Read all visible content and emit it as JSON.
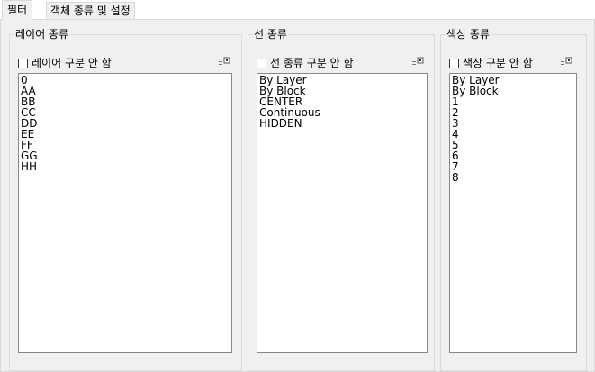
{
  "tabs": [
    {
      "label": "필터",
      "active": true
    },
    {
      "label": "객체 종류 및 설정",
      "active": false
    }
  ],
  "groups": {
    "layer": {
      "title": "레이어 종류",
      "checkbox_label": "레이어 구분 안 함",
      "checked": false,
      "items": [
        "0",
        "AA",
        "BB",
        "CC",
        "DD",
        "EE",
        "FF",
        "GG",
        "HH"
      ]
    },
    "line": {
      "title": "선 종류",
      "checkbox_label": "선 종류 구분 안 함",
      "checked": false,
      "items": [
        "By Layer",
        "By Block",
        "CENTER",
        "Continuous",
        "HIDDEN"
      ]
    },
    "color": {
      "title": "색상 종류",
      "checkbox_label": "색상 구분 안 함",
      "checked": false,
      "items": [
        "By Layer",
        "By Block",
        "1",
        "2",
        "3",
        "4",
        "5",
        "6",
        "7",
        "8"
      ]
    }
  },
  "icons": {
    "list_options": "list-options-icon"
  },
  "colors": {
    "panel_bg": "#f0f0f0",
    "listbox_border": "#828790"
  }
}
